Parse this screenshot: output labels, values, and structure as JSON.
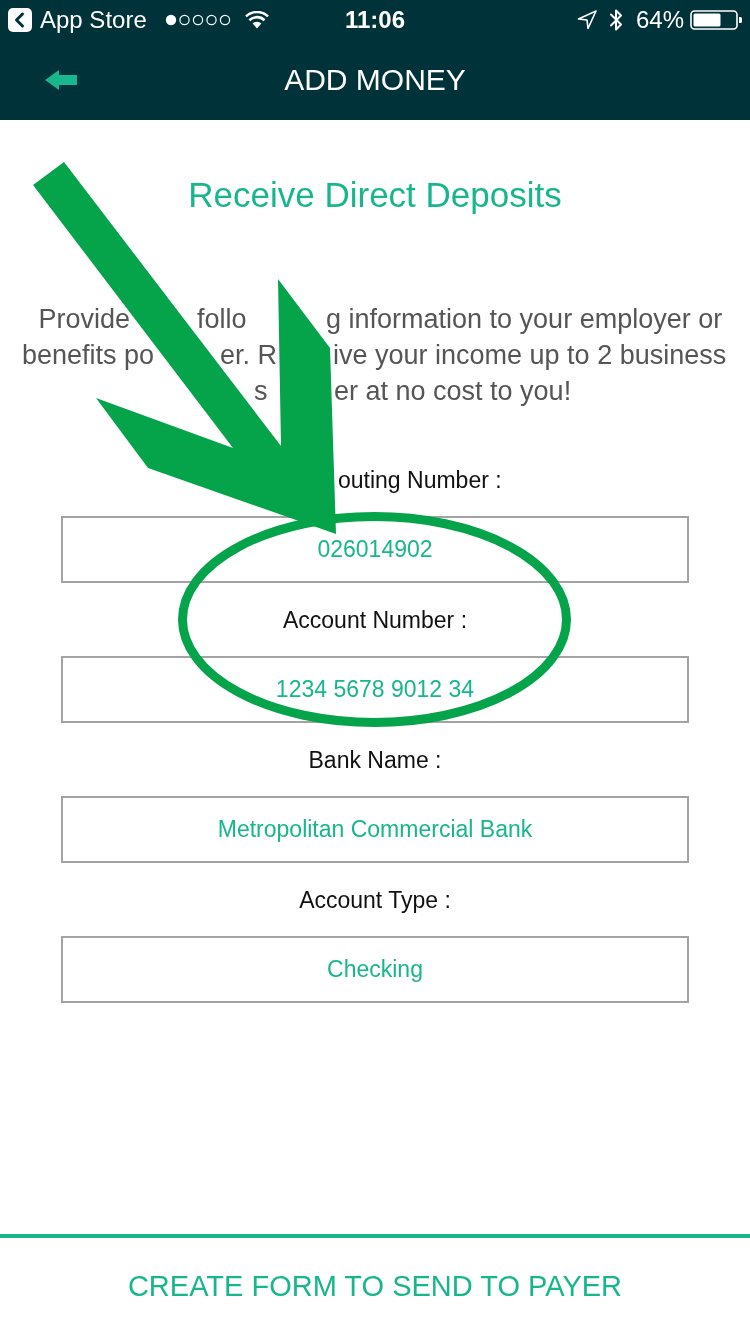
{
  "status_bar": {
    "back_label": "App Store",
    "time": "11:06",
    "battery_percent": "64%"
  },
  "header": {
    "title": "ADD MONEY"
  },
  "intro": {
    "title": "Receive Direct Deposits",
    "lines": [
      [
        "Provide",
        "follo",
        "g information to your employer or"
      ],
      [
        "benefits po",
        "er. R",
        "ive your income up to 2 business"
      ],
      [
        "s",
        "er at no cost to you!"
      ]
    ]
  },
  "fields": [
    {
      "label": "outing Number :",
      "value": "026014902"
    },
    {
      "label": "Account Number :",
      "value": "1234 5678 9012 34"
    },
    {
      "label": "Bank Name :",
      "value": "Metropolitan Commercial Bank"
    },
    {
      "label": "Account Type :",
      "value": "Checking"
    }
  ],
  "action": {
    "label": "CREATE FORM TO SEND TO PAYER"
  }
}
